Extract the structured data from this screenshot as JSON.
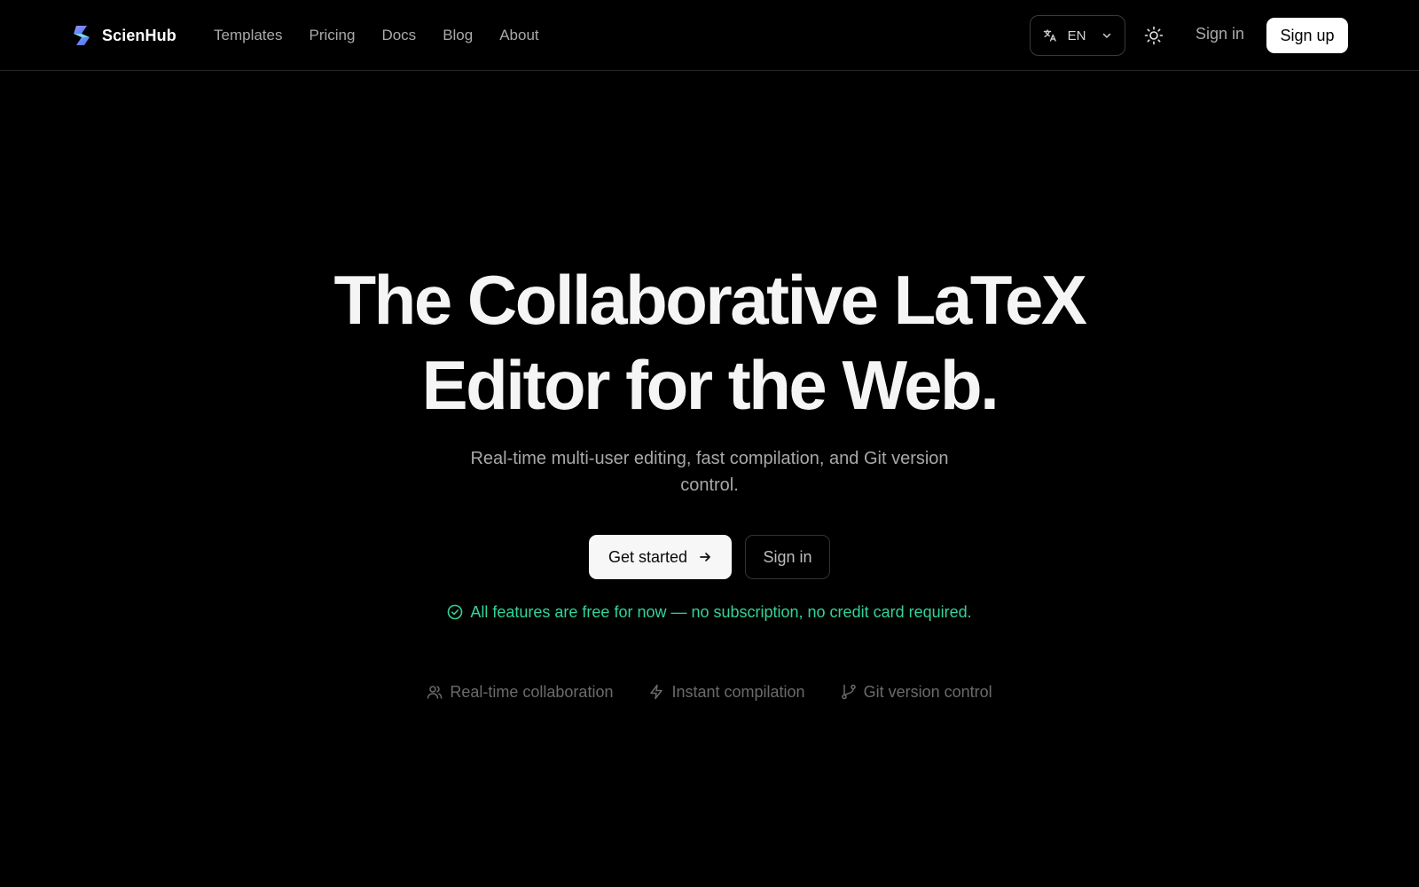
{
  "header": {
    "brand_name": "ScienHub",
    "brand_logo_icon": "scienhub-logo-icon",
    "nav": [
      {
        "label": "Templates"
      },
      {
        "label": "Pricing"
      },
      {
        "label": "Docs"
      },
      {
        "label": "Blog"
      },
      {
        "label": "About"
      }
    ],
    "language": {
      "value": "EN",
      "icon": "translate-icon",
      "chevron": "chevron-down-icon"
    },
    "theme_icon": "sun-icon",
    "sign_in_label": "Sign in",
    "sign_up_label": "Sign up"
  },
  "hero": {
    "title_line1": "The Collaborative LaTeX",
    "title_line2": "Editor for the Web.",
    "subtitle": "Real-time multi-user editing, fast compilation, and Git version control.",
    "primary_cta": {
      "label": "Get started",
      "icon": "arrow-right-icon"
    },
    "secondary_cta": {
      "label": "Sign in"
    },
    "free_note": {
      "text": "All features are free for now — no subscription, no credit card required.",
      "icon": "check-circle-icon",
      "color": "#34d399"
    },
    "features": [
      {
        "label": "Real-time collaboration",
        "icon": "users-icon"
      },
      {
        "label": "Instant compilation",
        "icon": "lightning-icon"
      },
      {
        "label": "Git version control",
        "icon": "git-branch-icon"
      }
    ]
  },
  "colors": {
    "background": "#000000",
    "text_primary": "#f5f5f5",
    "text_muted": "#a9a9a9",
    "accent_green": "#34d399",
    "button_light": "#ffffff"
  }
}
